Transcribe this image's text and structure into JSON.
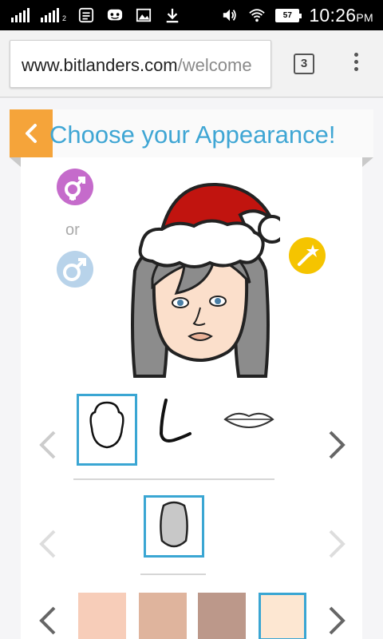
{
  "statusbar": {
    "time": "10:26",
    "ampm": "PM",
    "battery": "57",
    "sim2_label": "2",
    "icons": [
      "signal-icon",
      "signal-icon",
      "notes-icon",
      "chat-icon",
      "image-icon",
      "download-icon",
      "volume-icon",
      "wifi-icon",
      "battery-icon"
    ]
  },
  "browser": {
    "url_host": "www.bitlanders.com",
    "url_path": "/welcome",
    "tab_count": "3"
  },
  "header": {
    "back_icon": "chevron-left-icon",
    "title": "Choose your Appearance!"
  },
  "gender": {
    "female_icon": "female-symbol-icon",
    "or_text": "or",
    "male_icon": "male-symbol-icon",
    "random_icon": "magic-wand-icon"
  },
  "colors": {
    "accent": "#3fa6d4",
    "back_button": "#f5a43a",
    "female": "#c56bcb",
    "male": "#b8d3ea",
    "magic": "#f5c400"
  },
  "feature_row": {
    "items": [
      "face-shape-icon",
      "nose-icon",
      "lips-icon"
    ],
    "selected_index": 0
  },
  "shape_row": {
    "items": [
      "oval-shape-icon"
    ],
    "selected_index": 0
  },
  "skin_tones": {
    "swatches": [
      "#f7cdb9",
      "#dfb49d",
      "#bc988a",
      "#fde7d2"
    ],
    "selected_index": 3
  }
}
